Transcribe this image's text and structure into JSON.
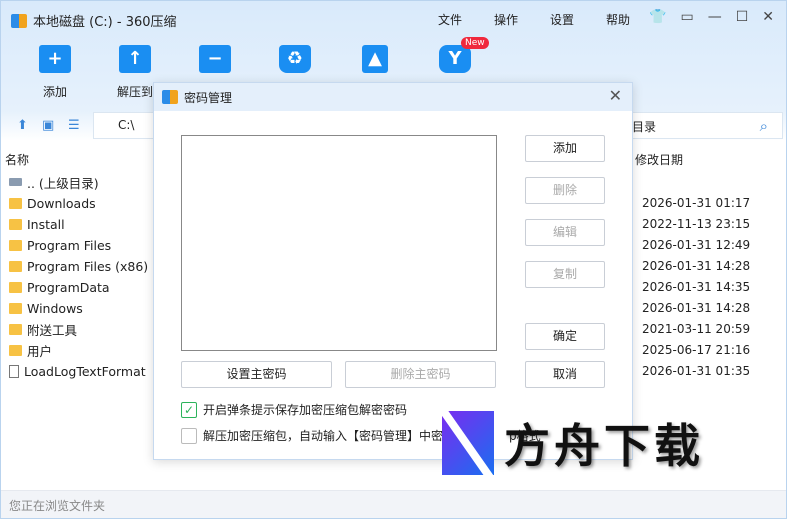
{
  "window": {
    "title": "本地磁盘 (C:) - 360压缩",
    "menu": [
      "文件",
      "操作",
      "设置",
      "帮助"
    ]
  },
  "toolbar": [
    {
      "label": "添加",
      "icon": "+"
    },
    {
      "label": "解压到",
      "icon": "↑"
    },
    {
      "label": "",
      "icon": "−"
    },
    {
      "label": "",
      "icon": "♻"
    },
    {
      "label": "",
      "icon": "▲"
    },
    {
      "label": "",
      "icon": "Y",
      "badge": "New"
    }
  ],
  "address": {
    "path": "C:\\",
    "search_placeholder": "目录"
  },
  "columns": {
    "name": "名称",
    "modified": "修改日期"
  },
  "files": [
    {
      "name": ".. (上级目录)",
      "type": "up",
      "date": ""
    },
    {
      "name": "Downloads",
      "type": "folder",
      "date": "2026-01-31 01:17"
    },
    {
      "name": "Install",
      "type": "folder",
      "date": "2022-11-13 23:15"
    },
    {
      "name": "Program Files",
      "type": "folder",
      "date": "2026-01-31 12:49"
    },
    {
      "name": "Program Files (x86)",
      "type": "folder",
      "date": "2026-01-31 14:28"
    },
    {
      "name": "ProgramData",
      "type": "folder",
      "date": "2026-01-31 14:35"
    },
    {
      "name": "Windows",
      "type": "folder",
      "date": "2026-01-31 14:28"
    },
    {
      "name": "附送工具",
      "type": "folder",
      "date": "2021-03-11 20:59"
    },
    {
      "name": "用户",
      "type": "folder",
      "date": "2025-06-17 21:16"
    },
    {
      "name": "LoadLogTextFormat",
      "type": "file",
      "date": "2026-01-31 01:35"
    }
  ],
  "status": "您正在浏览文件夹",
  "dialog": {
    "title": "密码管理",
    "add": "添加",
    "delete": "删除",
    "edit": "编辑",
    "copy": "复制",
    "ok": "确定",
    "cancel": "取消",
    "set_master": "设置主密码",
    "delete_master": "删除主密码",
    "opt1": "开启弹条提示保存加密压缩包解密密码",
    "opt2": "解压加密压缩包，自动输入【密码管理】中密",
    "opt2_tail": "p格式"
  },
  "watermark": "方舟下载"
}
